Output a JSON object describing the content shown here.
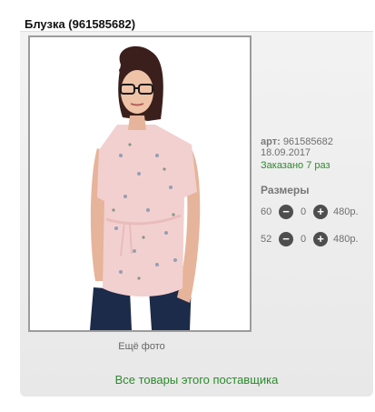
{
  "product": {
    "title": "Блузка (961585682)",
    "photo_alt": "Женщина в розовой блузке",
    "more_photos_label": "Ещё фото",
    "article_label": "арт:",
    "article_value": "961585682",
    "date": "18.09.2017",
    "ordered": "Заказано 7 раз",
    "sizes_label": "Размеры",
    "sizes": [
      {
        "size": "60",
        "qty": "0",
        "price": "480р."
      },
      {
        "size": "52",
        "qty": "0",
        "price": "480р."
      }
    ],
    "supplier_link": "Все товары этого поставщика"
  },
  "icons": {
    "minus": "minus-circle-icon",
    "plus": "plus-circle-icon"
  },
  "colors": {
    "accent_green": "#2c8a2c",
    "button_dark": "#4e4e4e"
  }
}
